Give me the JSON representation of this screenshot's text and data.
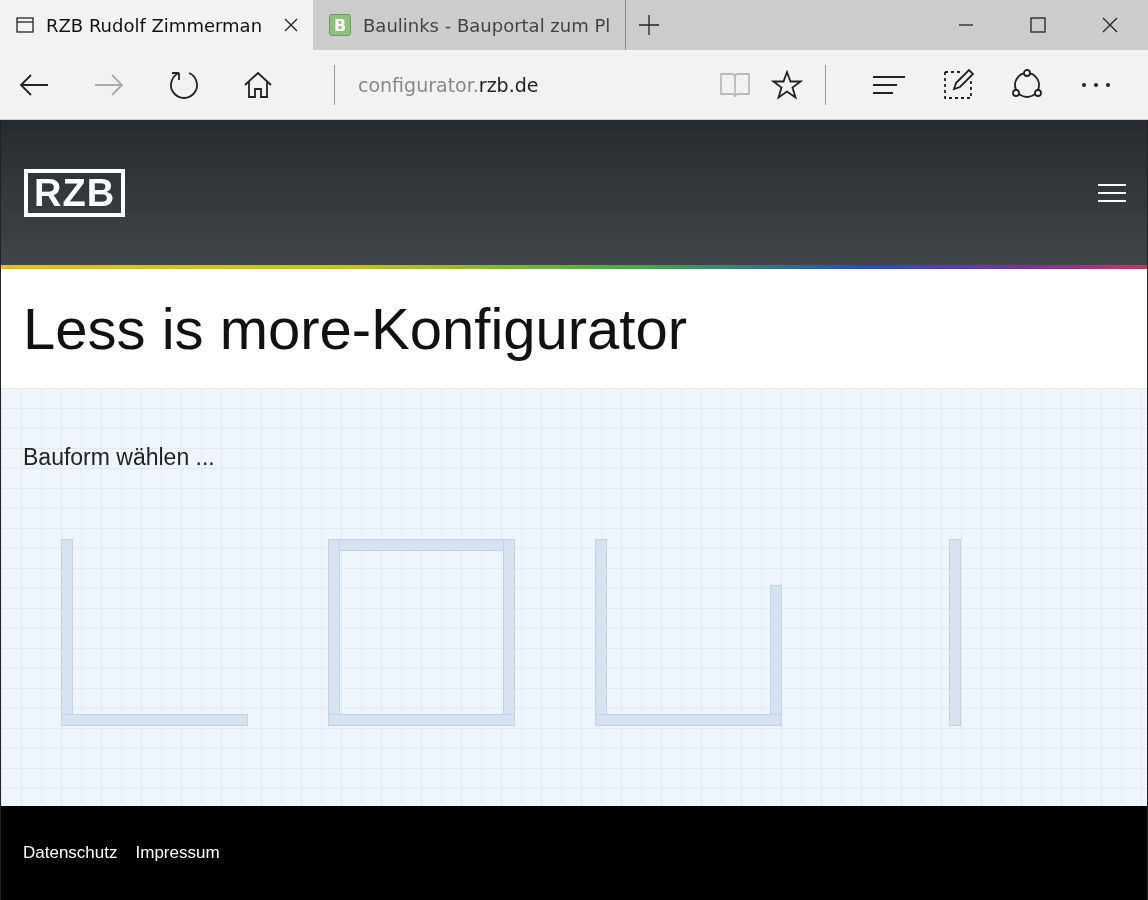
{
  "browser": {
    "tabs": [
      {
        "title": "RZB Rudolf Zimmerman",
        "selected": true,
        "kind": "page"
      },
      {
        "title": "Baulinks - Bauportal zum Pl",
        "selected": false,
        "kind": "letter",
        "favicon_text": "B"
      }
    ],
    "address": {
      "host_prefix": "configurator.",
      "domain": "rzb.de"
    }
  },
  "header": {
    "logo": "RZB"
  },
  "title": "Less is more-Konfigurator",
  "configurator": {
    "prompt": "Bauform wählen ...",
    "shapes": [
      {
        "kind": "l"
      },
      {
        "kind": "square"
      },
      {
        "kind": "u"
      },
      {
        "kind": "straight"
      }
    ]
  },
  "footer": {
    "links": [
      "Datenschutz",
      "Impressum"
    ]
  }
}
